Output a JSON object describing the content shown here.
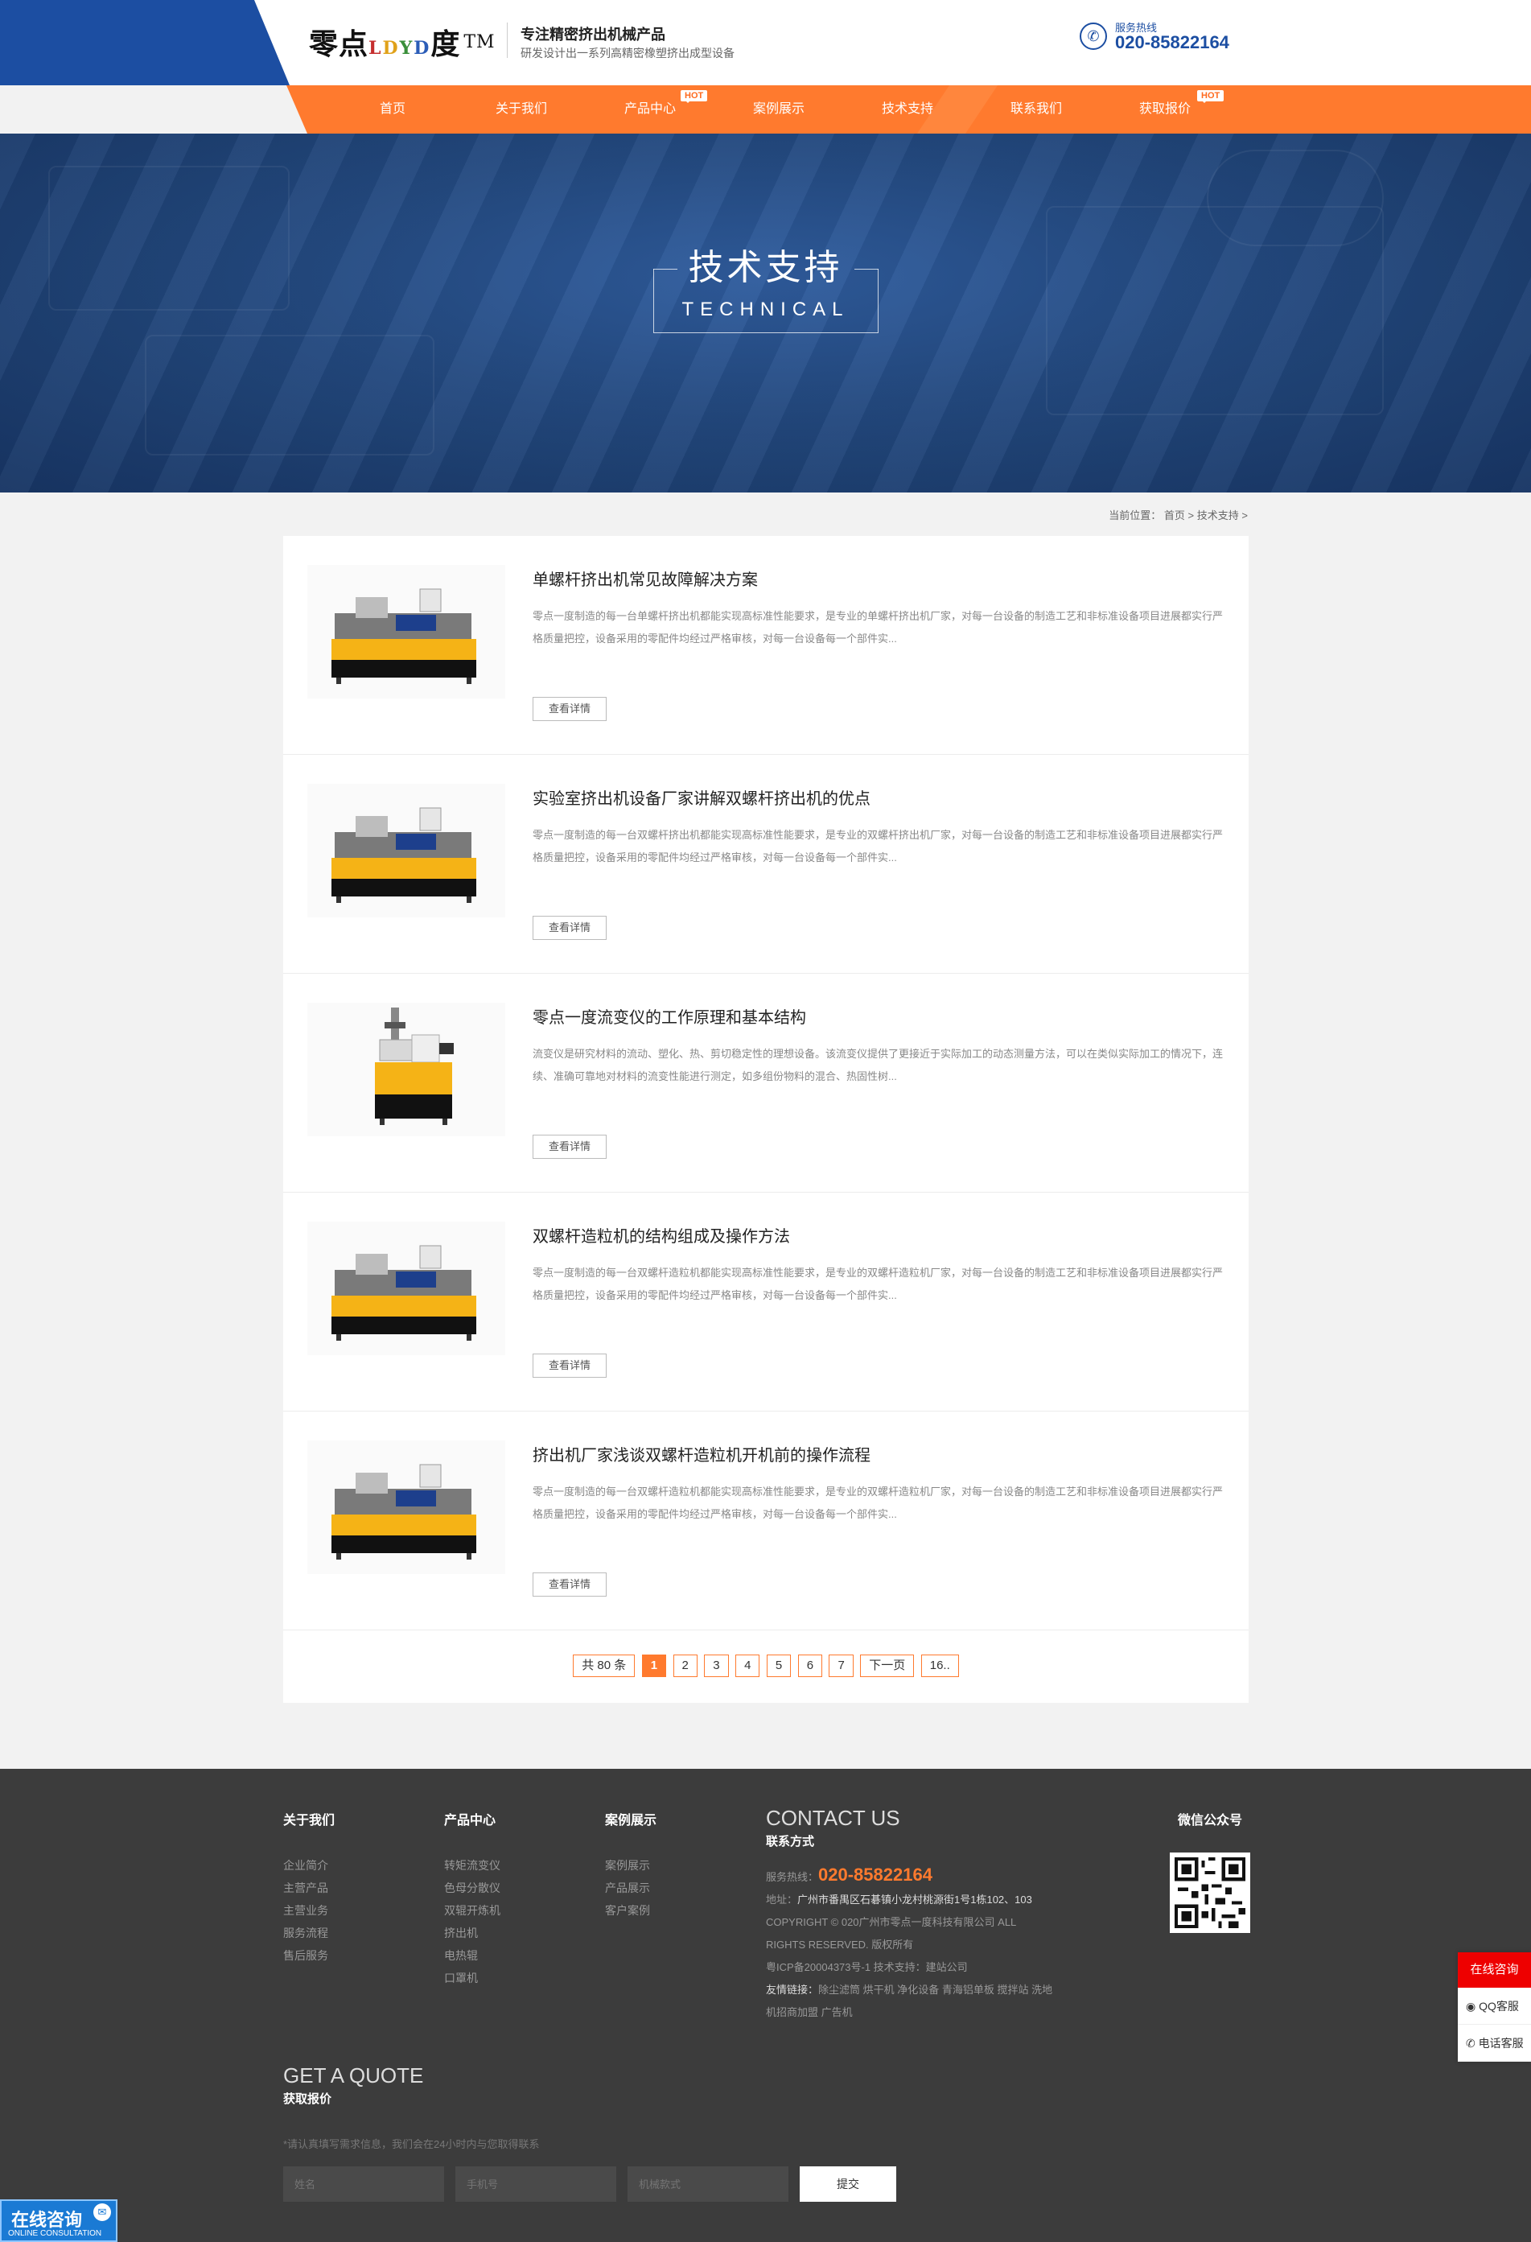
{
  "header": {
    "logo_prefix": "零点",
    "logo_letters": [
      "L",
      "D",
      "Y",
      "D",
      ""
    ],
    "logo_suffix": "度",
    "logo_tm": "TM",
    "slogan_main": "专注精密挤出机械产品",
    "slogan_sub": "研发设计出一系列高精密橡塑挤出成型设备",
    "phone_label": "服务热线",
    "phone_number": "020-85822164",
    "phone_icon": "phone-icon"
  },
  "nav": {
    "items": [
      {
        "label": "首页"
      },
      {
        "label": "关于我们"
      },
      {
        "label": "产品中心",
        "badge": "HOT"
      },
      {
        "label": "案例展示"
      },
      {
        "label": "技术支持"
      },
      {
        "label": "联系我们"
      },
      {
        "label": "获取报价",
        "badge": "HOT"
      }
    ],
    "accent_color": "#ff7a2e"
  },
  "banner": {
    "title": "技术支持",
    "subtitle": "TECHNICAL"
  },
  "breadcrumb": {
    "prefix": "当前位置：",
    "items": [
      "首页",
      "技术支持"
    ],
    "separator": ">"
  },
  "articles": [
    {
      "title": "单螺杆挤出机常见故障解决方案",
      "desc": "零点一度制造的每一台单螺杆挤出机都能实现高标准性能要求，是专业的单螺杆挤出机厂家，对每一台设备的制造工艺和非标准设备项目进展都实行严格质量把控，设备采用的零配件均经过严格审核，对每一台设备每一个部件实...",
      "button": "查看详情",
      "image": "extruder"
    },
    {
      "title": "实验室挤出机设备厂家讲解双螺杆挤出机的优点",
      "desc": "零点一度制造的每一台双螺杆挤出机都能实现高标准性能要求，是专业的双螺杆挤出机厂家，对每一台设备的制造工艺和非标准设备项目进展都实行严格质量把控，设备采用的零配件均经过严格审核，对每一台设备每一个部件实...",
      "button": "查看详情",
      "image": "extruder"
    },
    {
      "title": "零点一度流变仪的工作原理和基本结构",
      "desc": "流变仪是研究材料的流动、塑化、热、剪切稳定性的理想设备。该流变仪提供了更接近于实际加工的动态测量方法，可以在类似实际加工的情况下，连续、准确可靠地对材料的流变性能进行测定，如多组份物料的混合、热固性树...",
      "button": "查看详情",
      "image": "rheometer"
    },
    {
      "title": "双螺杆造粒机的结构组成及操作方法",
      "desc": "零点一度制造的每一台双螺杆造粒机都能实现高标准性能要求，是专业的双螺杆造粒机厂家，对每一台设备的制造工艺和非标准设备项目进展都实行严格质量把控，设备采用的零配件均经过严格审核，对每一台设备每一个部件实...",
      "button": "查看详情",
      "image": "extruder"
    },
    {
      "title": "挤出机厂家浅谈双螺杆造粒机开机前的操作流程",
      "desc": "零点一度制造的每一台双螺杆造粒机都能实现高标准性能要求，是专业的双螺杆造粒机厂家，对每一台设备的制造工艺和非标准设备项目进展都实行严格质量把控，设备采用的零配件均经过严格审核，对每一台设备每一个部件实...",
      "button": "查看详情",
      "image": "extruder"
    }
  ],
  "pagination": {
    "total": "共 80 条",
    "pages": [
      "1",
      "2",
      "3",
      "4",
      "5",
      "6",
      "7"
    ],
    "current": "1",
    "next": "下一页",
    "last": "16.."
  },
  "footer": {
    "columns": [
      {
        "title": "关于我们",
        "links": [
          "企业简介",
          "主营产品",
          "主营业务",
          "服务流程",
          "售后服务"
        ]
      },
      {
        "title": "产品中心",
        "links": [
          "转矩流变仪",
          "色母分散仪",
          "双辊开炼机",
          "挤出机",
          "电热辊",
          "口罩机"
        ]
      },
      {
        "title": "案例展示",
        "links": [
          "案例展示",
          "产品展示",
          "客户案例"
        ]
      }
    ],
    "contact": {
      "title_en": "CONTACT US",
      "title_cn": "联系方式",
      "hotline_label": "服务热线：",
      "hotline": "020-85822164",
      "address_label": "地址：",
      "address": "广州市番禺区石碁镇小龙村桃源街1号1栋102、103",
      "copyright": "COPYRIGHT © 020广州市零点一度科技有限公司 ALL RIGHTS RESERVED. 版权所有",
      "icp": "粤ICP备20004373号-1 技术支持：建站公司",
      "links_label": "友情链接：",
      "links": "除尘滤筒  烘干机  净化设备  青海铝单板  搅拌站  洗地机招商加盟  广告机"
    },
    "wechat_title": "微信公众号",
    "quote": {
      "title_en": "GET A QUOTE",
      "title_cn": "获取报价",
      "tip": "*请认真填写需求信息，我们会在24小时内与您取得联系",
      "name_placeholder": "姓名",
      "phone_placeholder": "手机号",
      "model_placeholder": "机械款式",
      "submit": "提交"
    }
  },
  "floating": {
    "online": "在线咨询",
    "qq": "QQ客服",
    "tel": "电话客服",
    "chat_cn": "在线咨询",
    "chat_en": "ONLINE CONSULTATION"
  }
}
